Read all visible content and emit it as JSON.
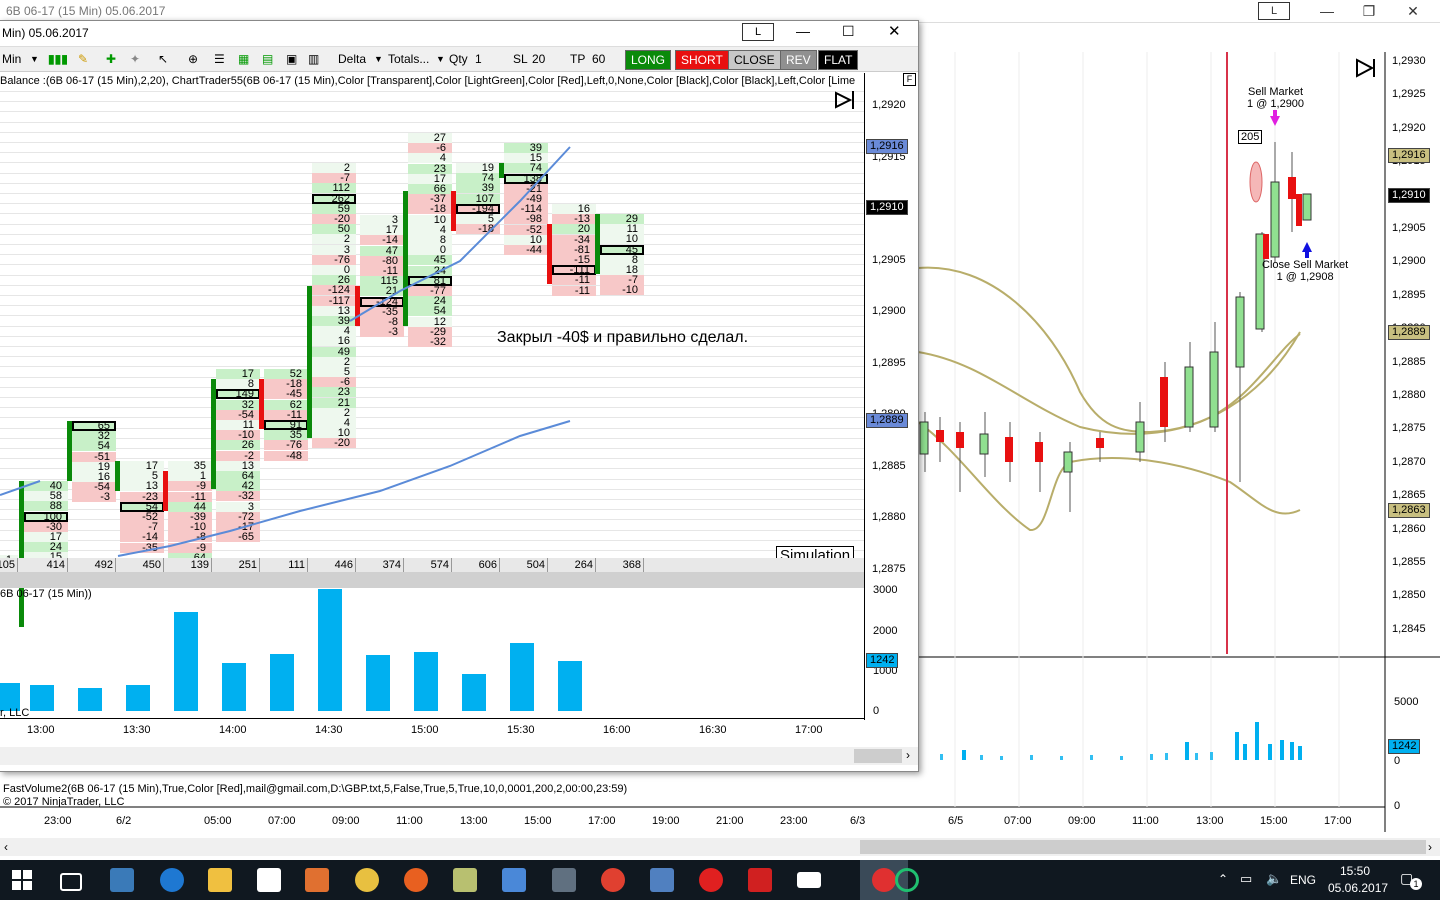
{
  "bg_window": {
    "title": "6B 06-17 (15 Min)  05.06.2017",
    "btn_l": "L",
    "min": "—",
    "max": "❐",
    "close": "✕",
    "orders": {
      "sell_market": "Sell Market",
      "sell_detail": "1 @ 1,2900",
      "close_sell": "Close Sell Market",
      "close_detail": "1 @ 1,2908",
      "marker": "205"
    },
    "price_axis": [
      "1,2930",
      "1,2925",
      "1,2920",
      "1,2915",
      "1,2910",
      "1,2905",
      "1,2900",
      "1,2895",
      "1,2890",
      "1,2885",
      "1,2880",
      "1,2875",
      "1,2870",
      "1,2865",
      "1,2860",
      "1,2855",
      "1,2850",
      "1,2845"
    ],
    "price_tags": {
      "t1": "1,2916",
      "t2": "1,2910",
      "t3": "1,2889",
      "t4": "1,2863"
    },
    "vol_axis": [
      "5000",
      "0",
      "0"
    ],
    "vol_tag": "1242",
    "time_axis": [
      "23:00",
      "6/2",
      "05:00",
      "07:00",
      "09:00",
      "11:00",
      "13:00",
      "15:00",
      "17:00",
      "19:00",
      "21:00",
      "23:00",
      "6/3",
      "6/5",
      "07:00",
      "09:00",
      "11:00",
      "13:00",
      "15:00",
      "17:00"
    ],
    "indicator_text": "FastVolume2(6B 06-17 (15 Min),True,Color [Red],mail@gmail.com,D:\\GBP.txt,5,False,True,5,True,10,0,0001,200,2,00:00,23:59)",
    "copyright": "© 2017 NinjaTrader, LLC"
  },
  "front_window": {
    "title": "Min)  05.06.2017",
    "btn_l": "L",
    "toolbar": {
      "interval": "Min",
      "delta": "Delta",
      "totals": "Totals...",
      "qty_label": "Qty",
      "qty": "1",
      "sl_label": "SL",
      "sl": "20",
      "tp_label": "TP",
      "tp": "60",
      "long": "LONG",
      "short": "SHORT",
      "close": "CLOSE",
      "rev": "REV",
      "flat": "FLAT"
    },
    "indicator_line": "Balance  :(6B 06-17 (15 Min),2,20), ChartTrader55(6B 06-17 (15 Min),Color [Transparent],Color [LightGreen],Color [Red],Left,0,None,Color [Black],Color [Black],Left,Color [Lime",
    "annotation": "Закрыл -40$ и правильно сделал.",
    "simulation": "Simulation",
    "price_axis": [
      "1,2920",
      "1,2915",
      "1,2910",
      "1,2905",
      "1,2900",
      "1,2895",
      "1,2890",
      "1,2885",
      "1,2880",
      "1,2875"
    ],
    "price_tags": {
      "a": "1,2916",
      "b": "1,2910",
      "c": "1,2889"
    },
    "volume_totals": [
      "105",
      "414",
      "492",
      "450",
      "139",
      "251",
      "111",
      "446",
      "374",
      "574",
      "606",
      "504",
      "264",
      "368"
    ],
    "vol_title": "6B 06-17 (15 Min))",
    "vol_axis": [
      "3000",
      "2000",
      "1000",
      "0"
    ],
    "vol_tag": "1242",
    "vol_values": [
      700,
      650,
      560,
      650,
      2430,
      1190,
      1410,
      2990,
      1370,
      1450,
      920,
      1660,
      1220
    ],
    "llc": "r, LLC",
    "time_axis": [
      "13:00",
      "13:30",
      "14:00",
      "14:30",
      "15:00",
      "15:30",
      "16:00",
      "16:30",
      "17:00"
    ]
  },
  "taskbar": {
    "lang": "ENG",
    "time": "15:50",
    "date": "05.06.2017",
    "notif": "1"
  }
}
